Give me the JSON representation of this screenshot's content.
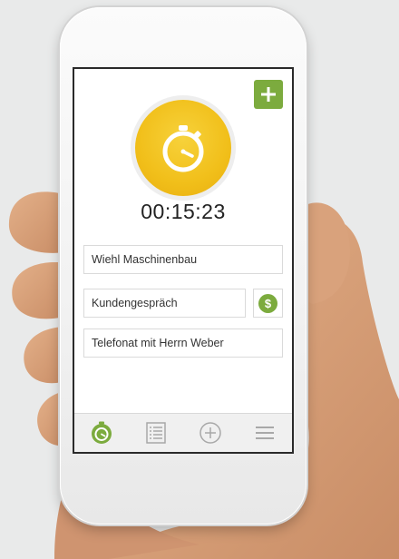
{
  "app": {
    "add_icon": "plus-icon",
    "timer_icon": "stopwatch-icon",
    "timer_value": "00:15:23",
    "fields": {
      "customer": "Wiehl Maschinenbau",
      "activity": "Kundengespräch",
      "note": "Telefonat mit Herrn Weber"
    },
    "billable_icon": "dollar-icon",
    "billable_symbol": "$",
    "tabs": [
      {
        "icon": "stopwatch-icon",
        "active": true
      },
      {
        "icon": "list-icon",
        "active": false
      },
      {
        "icon": "plus-circle-icon",
        "active": false
      },
      {
        "icon": "menu-icon",
        "active": false
      }
    ]
  },
  "colors": {
    "accent_green": "#7cab3e",
    "timer_yellow": "#f1bf1a",
    "icon_grey": "#a8a8a8",
    "background": "#e9eaea"
  }
}
